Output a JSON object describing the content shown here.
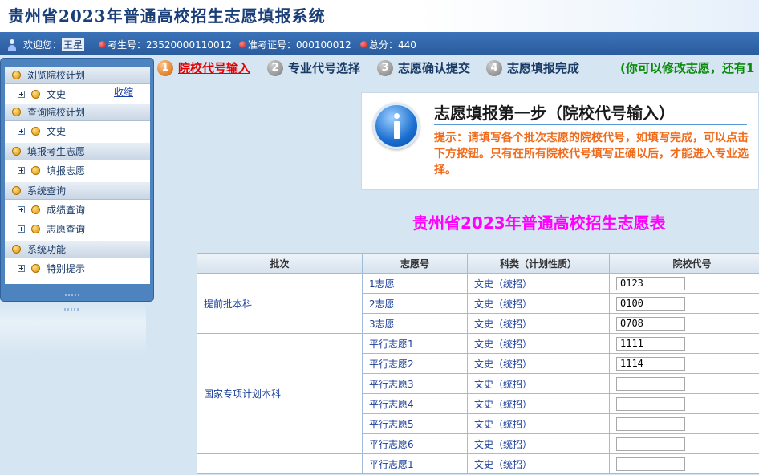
{
  "header": {
    "title": "贵州省2023年普通高校招生志愿填报系统"
  },
  "infobar": {
    "welcome": "欢迎您：",
    "user_name": "王星",
    "exam_no": "考生号：23520000110012",
    "ticket_no": "准考证号：000100012",
    "total": "总分：440"
  },
  "sidebar": {
    "collapse_label": "收缩",
    "sections": [
      {
        "title": "浏览院校计划",
        "items": [
          "文史"
        ]
      },
      {
        "title": "查询院校计划",
        "items": [
          "文史"
        ]
      },
      {
        "title": "填报考生志愿",
        "items": [
          "填报志愿"
        ]
      },
      {
        "title": "系统查询",
        "items": [
          "成绩查询",
          "志愿查询"
        ]
      },
      {
        "title": "系统功能",
        "items": [
          "特别提示"
        ]
      }
    ]
  },
  "steps": [
    {
      "num": "1",
      "label": "院校代号输入"
    },
    {
      "num": "2",
      "label": "专业代号选择"
    },
    {
      "num": "3",
      "label": "志愿确认提交"
    },
    {
      "num": "4",
      "label": "志愿填报完成"
    }
  ],
  "step_note": "(你可以修改志愿，还有1",
  "info": {
    "title": "志愿填报第一步（院校代号输入）",
    "text": "提示：请填写各个批次志愿的院校代号，如填写完成，可以点击下方按钮。只有在所有院校代号填写正确以后，才能进入专业选择。"
  },
  "form": {
    "title": "贵州省2023年普通高校招生志愿表",
    "columns": [
      "批次",
      "志愿号",
      "科类（计划性质）",
      "院校代号"
    ],
    "batches": [
      {
        "name": "提前批本科",
        "rows": [
          {
            "choice": "1志愿",
            "category": "文史（统招）",
            "code": "0123"
          },
          {
            "choice": "2志愿",
            "category": "文史（统招）",
            "code": "0100"
          },
          {
            "choice": "3志愿",
            "category": "文史（统招）",
            "code": "0708"
          }
        ]
      },
      {
        "name": "国家专项计划本科",
        "rows": [
          {
            "choice": "平行志愿1",
            "category": "文史（统招）",
            "code": "1111"
          },
          {
            "choice": "平行志愿2",
            "category": "文史（统招）",
            "code": "1114"
          },
          {
            "choice": "平行志愿3",
            "category": "文史（统招）",
            "code": ""
          },
          {
            "choice": "平行志愿4",
            "category": "文史（统招）",
            "code": ""
          },
          {
            "choice": "平行志愿5",
            "category": "文史（统招）",
            "code": ""
          },
          {
            "choice": "平行志愿6",
            "category": "文史（统招）",
            "code": ""
          }
        ]
      },
      {
        "name": "",
        "rows": [
          {
            "choice": "平行志愿1",
            "category": "文史（统招）",
            "code": ""
          }
        ]
      }
    ]
  }
}
